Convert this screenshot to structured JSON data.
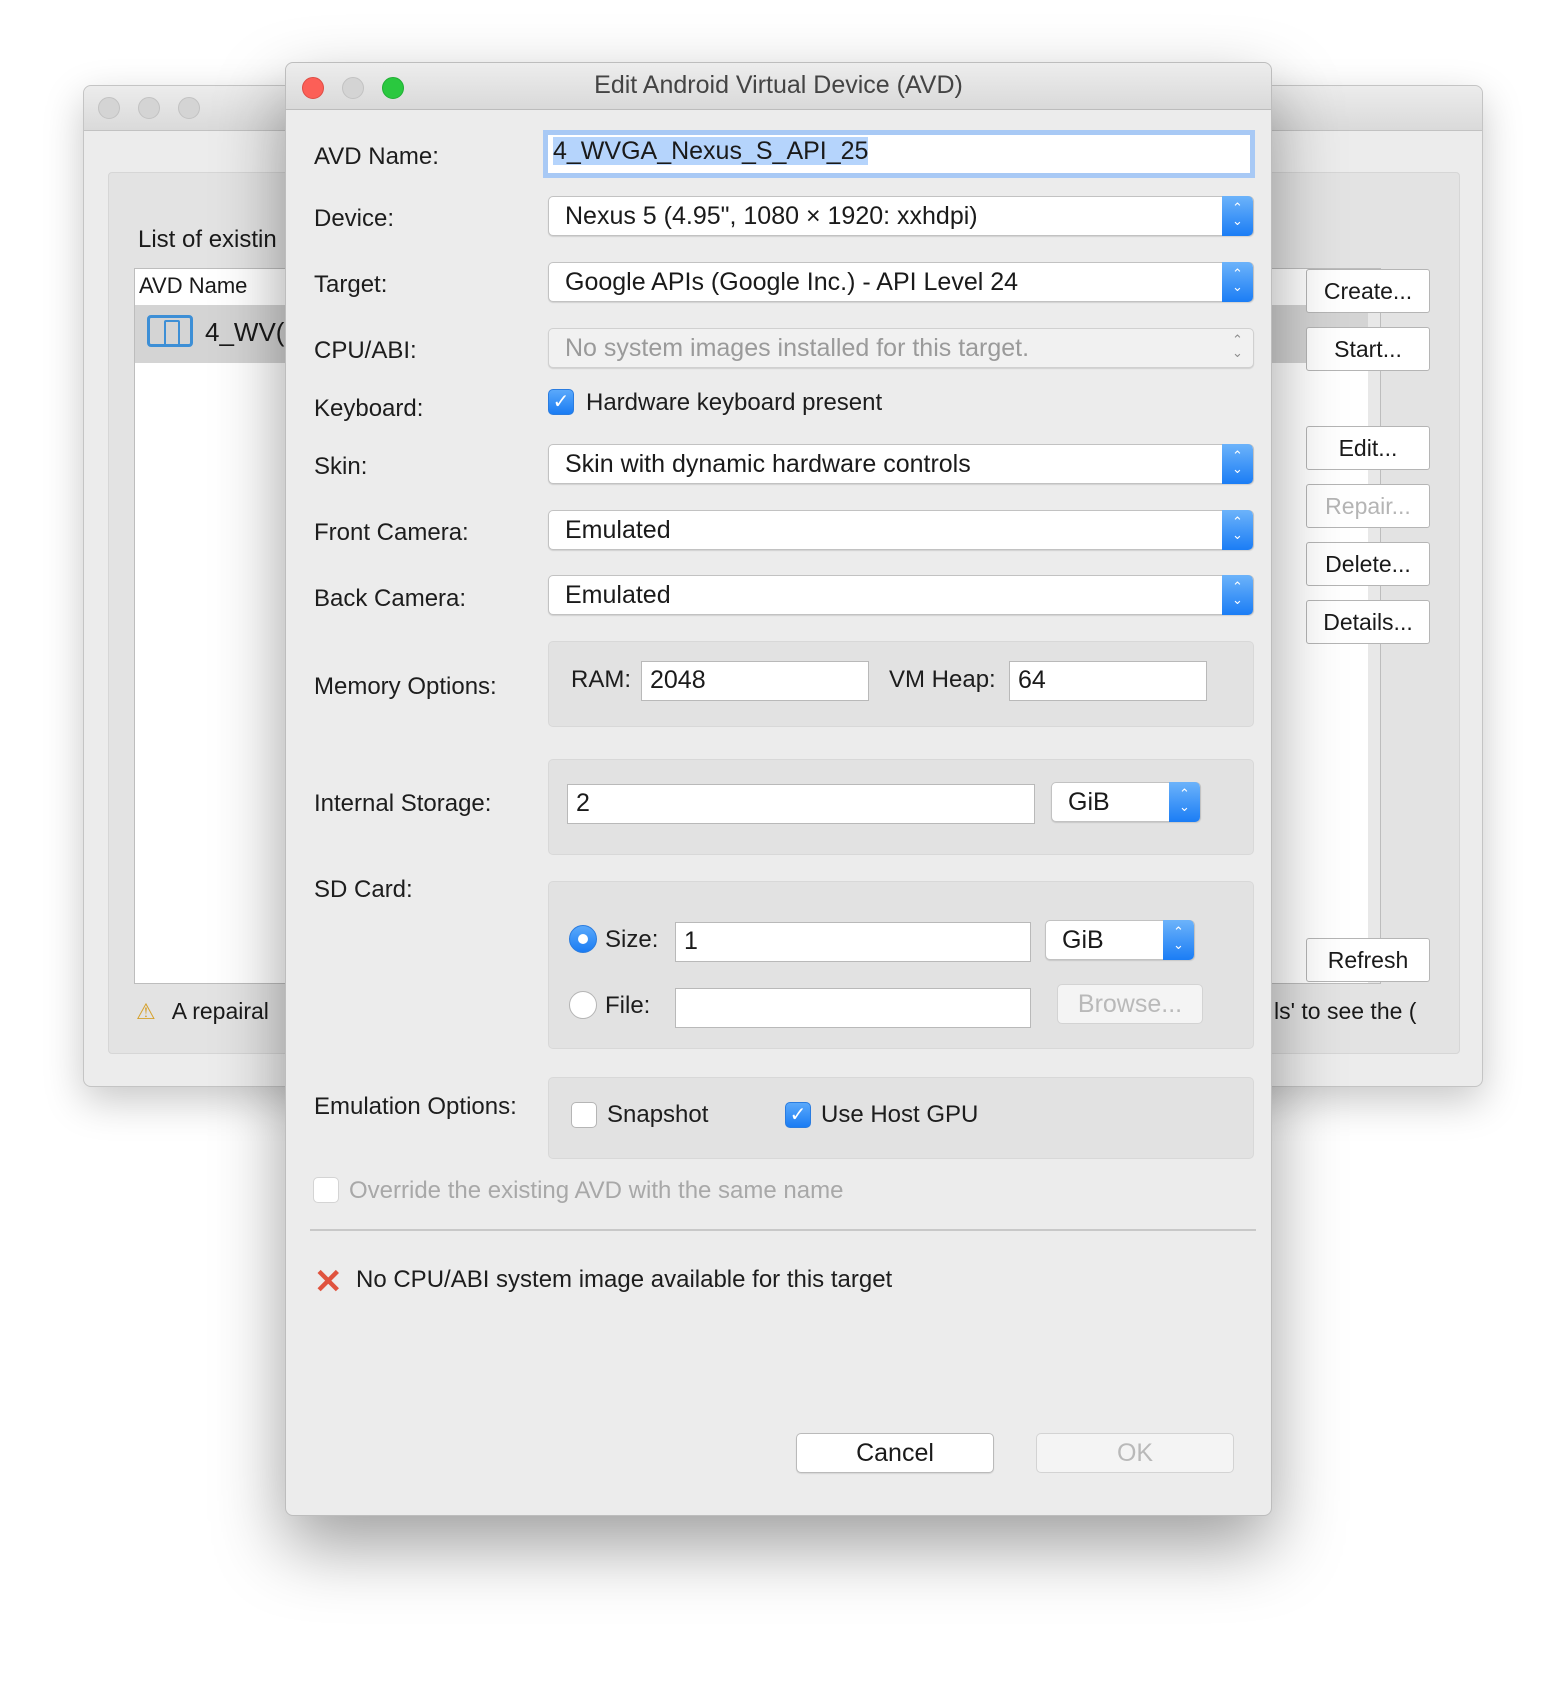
{
  "background_window": {
    "list_caption": "List of existin",
    "column_header": "AVD Name",
    "row_label": "4_WV(",
    "buttons": {
      "create": "Create...",
      "start": "Start...",
      "edit": "Edit...",
      "repair": "Repair...",
      "delete": "Delete...",
      "details": "Details...",
      "refresh": "Refresh"
    },
    "warning_left": "A repairal",
    "warning_right": "ls' to see the ("
  },
  "dialog": {
    "title": "Edit Android Virtual Device (AVD)",
    "labels": {
      "avd_name": "AVD Name:",
      "device": "Device:",
      "target": "Target:",
      "cpu_abi": "CPU/ABI:",
      "keyboard": "Keyboard:",
      "skin": "Skin:",
      "front_camera": "Front Camera:",
      "back_camera": "Back Camera:",
      "memory_options": "Memory Options:",
      "internal_storage": "Internal Storage:",
      "sd_card": "SD Card:",
      "emulation_options": "Emulation Options:"
    },
    "avd_name_value": "4_WVGA_Nexus_S_API_25",
    "device_value": "Nexus 5 (4.95\", 1080 × 1920: xxhdpi)",
    "target_value": "Google APIs (Google Inc.) - API Level 24",
    "cpu_abi_value": "No system images installed for this target.",
    "keyboard_checkbox_label": "Hardware keyboard present",
    "skin_value": "Skin with dynamic hardware controls",
    "front_camera_value": "Emulated",
    "back_camera_value": "Emulated",
    "memory": {
      "ram_label": "RAM:",
      "ram_value": "2048",
      "vm_heap_label": "VM Heap:",
      "vm_heap_value": "64"
    },
    "internal_storage": {
      "value": "2",
      "unit": "GiB"
    },
    "sd_card": {
      "size_label": "Size:",
      "size_value": "1",
      "size_unit": "GiB",
      "file_label": "File:",
      "file_value": "",
      "browse_label": "Browse..."
    },
    "emulation": {
      "snapshot_label": "Snapshot",
      "host_gpu_label": "Use Host GPU"
    },
    "override_label": "Override the existing AVD with the same name",
    "error_message": "No CPU/ABI system image available for this target",
    "cancel_label": "Cancel",
    "ok_label": "OK"
  },
  "icons": {
    "check": "✓",
    "error": "✕",
    "warning": "⚠",
    "stepper": "⌃⌄"
  },
  "colors": {
    "accent": "#1b7df5",
    "error": "#e0533e",
    "close": "#fc5f57",
    "zoom": "#2ac83f"
  }
}
